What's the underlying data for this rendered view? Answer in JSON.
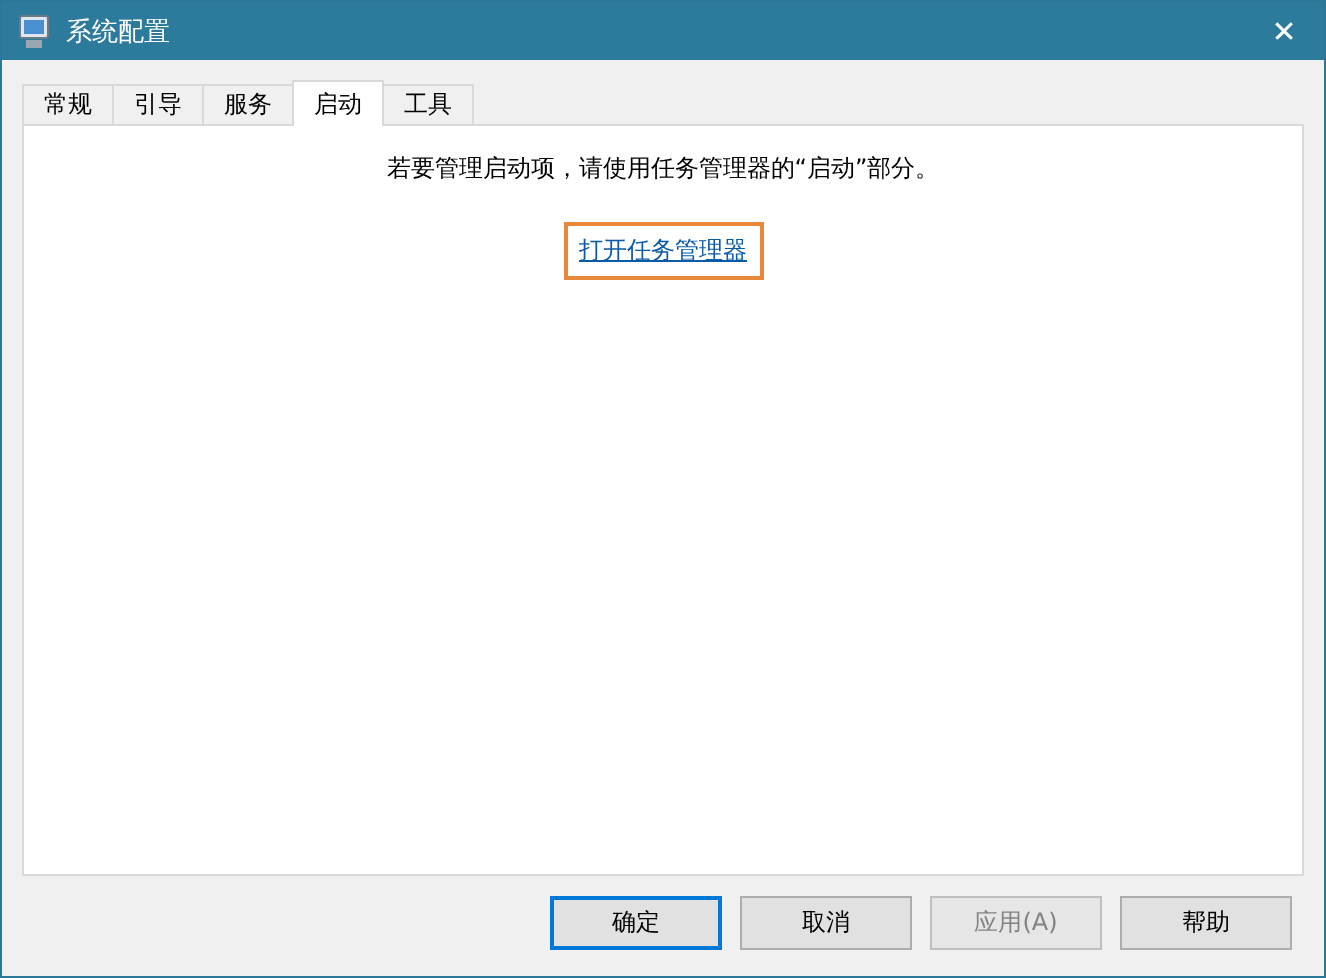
{
  "window": {
    "title": "系统配置",
    "close": "✕"
  },
  "tabs": [
    {
      "label": "常规",
      "selected": false
    },
    {
      "label": "引导",
      "selected": false
    },
    {
      "label": "服务",
      "selected": false
    },
    {
      "label": "启动",
      "selected": true
    },
    {
      "label": "工具",
      "selected": false
    }
  ],
  "panel": {
    "message": "若要管理启动项，请使用任务管理器的“启动”部分。",
    "link": {
      "label": "打开任务管理器",
      "highlighted": true
    }
  },
  "buttons": [
    {
      "label": "确定",
      "default": true,
      "disabled": false
    },
    {
      "label": "取消",
      "default": false,
      "disabled": false
    },
    {
      "label": "应用(A)",
      "default": false,
      "disabled": true
    },
    {
      "label": "帮助",
      "default": false,
      "disabled": false
    }
  ]
}
